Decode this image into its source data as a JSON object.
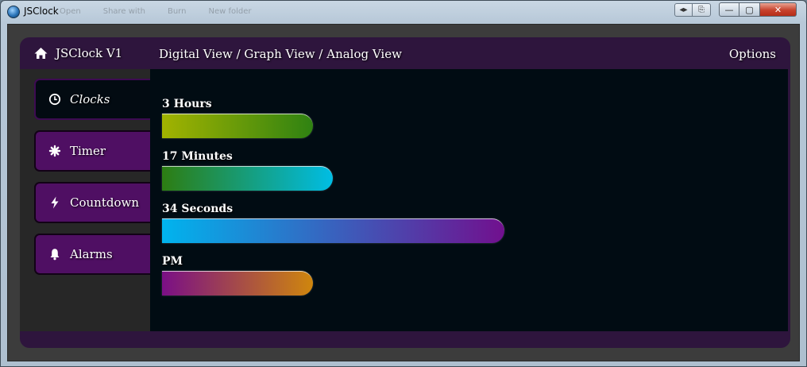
{
  "window": {
    "title": "JSClock",
    "ghost_toolbar": [
      "Open",
      "Share with",
      "Burn",
      "New folder"
    ],
    "nav_back": "◂▸",
    "nav_forward": "⎘",
    "minimize": "—",
    "maximize": "▢",
    "close": "✕"
  },
  "app": {
    "brand": "JSClock V1",
    "brand_icon": "home-icon",
    "views": "Digital View / Graph View / Analog View",
    "options": "Options",
    "colors": {
      "frame": "#2e153d",
      "sidebar_item": "#4f0f63",
      "content_bg": "#010c13"
    }
  },
  "sidebar": {
    "items": [
      {
        "label": "Clocks",
        "icon": "clock-icon",
        "active": true
      },
      {
        "label": "Timer",
        "icon": "gear-icon",
        "active": false
      },
      {
        "label": "Countdown",
        "icon": "lightning-icon",
        "active": false
      },
      {
        "label": "Alarms",
        "icon": "bell-icon",
        "active": false
      }
    ]
  },
  "graph": {
    "metrics": [
      {
        "label": "3 Hours",
        "value": 3,
        "max": 12,
        "colors": [
          "#a2b300",
          "#2f8212"
        ]
      },
      {
        "label": "17 Minutes",
        "value": 17,
        "max": 60,
        "colors": [
          "#2d7d12",
          "#00bde4"
        ]
      },
      {
        "label": "34 Seconds",
        "value": 34,
        "max": 60,
        "colors": [
          "#00b4ee",
          "#71108e"
        ]
      },
      {
        "label": "PM",
        "value": 1,
        "max": 4,
        "colors": [
          "#7a0f86",
          "#cf860d"
        ]
      }
    ]
  }
}
